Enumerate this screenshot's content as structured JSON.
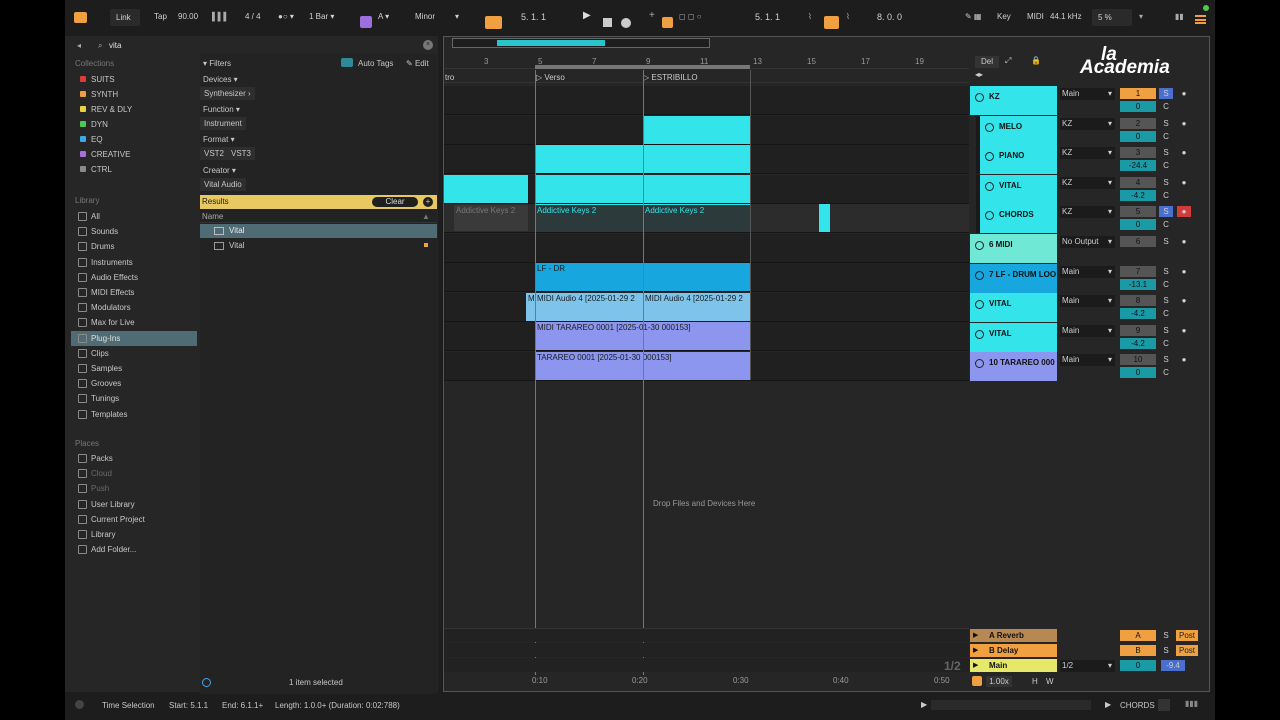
{
  "toolbar": {
    "link": "Link",
    "tap": "Tap",
    "tempo": "90.00",
    "signature": "4 / 4",
    "quant": "1 Bar",
    "key": "A",
    "scale": "Minor",
    "position": "5.  1.  1",
    "loop_start": "5.  1.  1",
    "loop_length": "8.  0.  0",
    "key_label": "Key",
    "midi_label": "MIDI",
    "sample_rate": "44.1 kHz",
    "cpu": "5 %"
  },
  "browser": {
    "search_value": "vita",
    "collections_title": "Collections",
    "collections": [
      {
        "label": "SUITS",
        "color": "#e03b3b"
      },
      {
        "label": "SYNTH",
        "color": "#f0a040"
      },
      {
        "label": "REV & DLY",
        "color": "#e8d440"
      },
      {
        "label": "DYN",
        "color": "#4ec94e"
      },
      {
        "label": "EQ",
        "color": "#3fa7e8"
      },
      {
        "label": "CREATIVE",
        "color": "#a76ee0"
      },
      {
        "label": "CTRL",
        "color": "#8a8a8a"
      }
    ],
    "library_title": "Library",
    "library": [
      "All",
      "Sounds",
      "Drums",
      "Instruments",
      "Audio Effects",
      "MIDI Effects",
      "Modulators",
      "Max for Live",
      "Plug-Ins",
      "Clips",
      "Samples",
      "Grooves",
      "Tunings",
      "Templates"
    ],
    "places_title": "Places",
    "places": [
      "Packs",
      "Cloud",
      "Push",
      "User Library",
      "Current Project",
      "Library",
      "Add Folder..."
    ],
    "filters": {
      "title": "Filters",
      "auto_tags": "Auto Tags",
      "edit": "Edit",
      "devices": "Devices",
      "devices_value": "Synthesizer",
      "function": "Function",
      "function_value": "Instrument",
      "format": "Format",
      "format_values": [
        "VST2",
        "VST3"
      ],
      "creator": "Creator",
      "creator_value": "Vital Audio",
      "results": "Results",
      "clear": "Clear",
      "name_header": "Name",
      "items": [
        "Vital",
        "Vital"
      ],
      "selected_count": "1 item selected"
    }
  },
  "arrangement": {
    "bars": [
      "3",
      "5",
      "7",
      "9",
      "11",
      "13",
      "15",
      "17",
      "19"
    ],
    "locators": [
      "tro",
      "Verso",
      "ESTRIBILLO"
    ],
    "clips": {
      "addictive_ghost": "Addictive Keys 2",
      "addictive_a": "Addictive Keys 2",
      "addictive_b": "Addictive Keys 2",
      "drum_loop": "LF - DR",
      "midi_audio_a": "MIDI Audio 4 [2025-01-29 2",
      "midi_audio_b": "MIDI Audio 4 [2025-01-29 2",
      "midi_audio_m": "M",
      "midi_tarareo": "MIDI TARAREO 0001 [2025-01-30 000153]",
      "tarareo": "TARAREO 0001 [2025-01-30 000153]"
    },
    "drop_hint": "Drop Files and Devices Here",
    "time_ticks": [
      "0:10",
      "0:20",
      "0:30",
      "0:40",
      "0:50"
    ],
    "page": "1/2"
  },
  "mixer": {
    "del": "Del",
    "tracks": [
      {
        "name": "KZ",
        "route": "Main",
        "num": "1",
        "vol": "0",
        "pan": "C",
        "color": "#33e5ea"
      },
      {
        "name": "MELO",
        "route": "KZ",
        "num": "2",
        "vol": "0",
        "pan": "C",
        "color": "#33e5ea"
      },
      {
        "name": "PIANO",
        "route": "KZ",
        "num": "3",
        "vol": "-24.4",
        "pan": "C",
        "color": "#33e5ea"
      },
      {
        "name": "VITAL",
        "route": "KZ",
        "num": "4",
        "vol": "-4.2",
        "pan": "C",
        "color": "#33e5ea"
      },
      {
        "name": "CHORDS",
        "route": "KZ",
        "num": "5",
        "vol": "0",
        "pan": "C",
        "color": "#33e5ea"
      },
      {
        "name": "6 MIDI",
        "route": "No Output",
        "num": "6",
        "vol": "",
        "pan": "",
        "color": "#6fe8d6"
      },
      {
        "name": "7 LF - DRUM LOO",
        "route": "Main",
        "num": "7",
        "vol": "-13.1",
        "pan": "C",
        "color": "#18a6df"
      },
      {
        "name": "VITAL",
        "route": "Main",
        "num": "8",
        "vol": "-4.2",
        "pan": "C",
        "color": "#33e5ea"
      },
      {
        "name": "VITAL",
        "route": "Main",
        "num": "9",
        "vol": "-4.2",
        "pan": "C",
        "color": "#33e5ea"
      },
      {
        "name": "10 TARAREO 000",
        "route": "Main",
        "num": "10",
        "vol": "0",
        "pan": "C",
        "color": "#8c96ee"
      }
    ],
    "returns": [
      {
        "name": "A Reverb",
        "letter": "A",
        "post": "Post",
        "color": "#b88852"
      },
      {
        "name": "B Delay",
        "letter": "B",
        "post": "Post",
        "color": "#f0a040"
      }
    ],
    "main": {
      "name": "Main",
      "route": "1/2",
      "vol": "0",
      "level": "-9.4"
    },
    "zoom": "1.00x",
    "h": "H",
    "w": "W",
    "logo_top": "la",
    "logo_main": "Academia"
  },
  "status": {
    "selection": "Time Selection",
    "start": "Start: 5.1.1",
    "end": "End: 6.1.1+",
    "length": "Length: 1.0.0+ (Duration: 0:02:788)",
    "track": "CHORDS"
  }
}
